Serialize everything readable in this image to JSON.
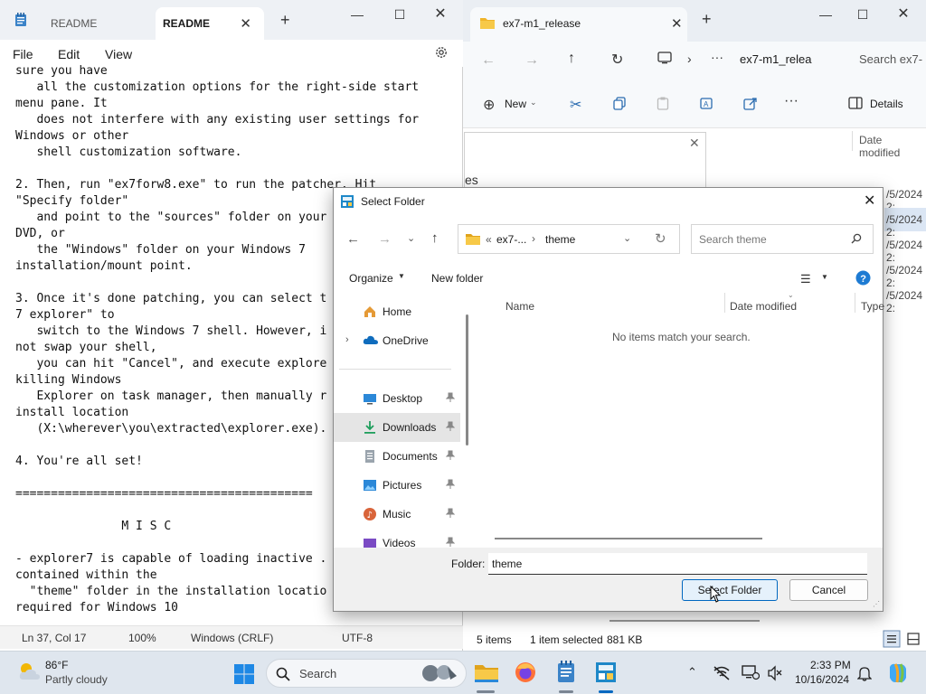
{
  "notepad": {
    "tabs": [
      "README",
      "README"
    ],
    "menu": [
      "File",
      "Edit",
      "View"
    ],
    "content": "sure you have\n   all the customization options for the right-side start\nmenu pane. It\n   does not interfere with any existing user settings for\nWindows or other\n   shell customization software.\n\n2. Then, run \"ex7forw8.exe\" to run the patcher. Hit\n\"Specify folder\"\n   and point to the \"sources\" folder on your\nDVD, or\n   the \"Windows\" folder on your Windows 7\ninstallation/mount point.\n\n3. Once it's done patching, you can select t\n7 explorer\" to\n   switch to the Windows 7 shell. However, i\nnot swap your shell,\n   you can hit \"Cancel\", and execute explore\nkilling Windows\n   Explorer on task manager, then manually r\ninstall location\n   (X:\\wherever\\you\\extracted\\explorer.exe).\n\n4. You're all set!\n\n==========================================\n\n               M I S C\n\n- explorer7 is capable of loading inactive .\ncontained within the\n  \"theme\" folder in the installation locatio\nrequired for Windows 10\n",
    "status": {
      "position": "Ln 37, Col 17",
      "zoom": "100%",
      "line_ending": "Windows (CRLF)",
      "encoding": "UTF-8"
    }
  },
  "explorer": {
    "tab_title": "ex7-m1_release",
    "address": "ex7-m1_relea",
    "search": "Search ex7-",
    "toolbar": {
      "new": "New",
      "details": "Details"
    },
    "column_date": "Date modified",
    "partial_dates": [
      "/5/2024 2:",
      "/5/2024 2:",
      "/5/2024 2:",
      "/5/2024 2:",
      "/5/2024 2:"
    ],
    "fragment": "es",
    "status": {
      "items": "5 items",
      "selected": "1 item selected",
      "size": "881 KB"
    }
  },
  "dialog": {
    "title": "Select Folder",
    "breadcrumb": [
      "«",
      "ex7-...",
      "›",
      "theme"
    ],
    "search_placeholder": "Search theme",
    "organize": "Organize",
    "new_folder": "New folder",
    "nav": [
      {
        "label": "Home",
        "icon": "home-icon"
      },
      {
        "label": "OneDrive",
        "icon": "onedrive-icon"
      },
      {
        "label": "Desktop",
        "icon": "desktop-icon"
      },
      {
        "label": "Downloads",
        "icon": "downloads-icon"
      },
      {
        "label": "Documents",
        "icon": "documents-icon"
      },
      {
        "label": "Pictures",
        "icon": "pictures-icon"
      },
      {
        "label": "Music",
        "icon": "music-icon"
      },
      {
        "label": "Videos",
        "icon": "videos-icon"
      }
    ],
    "columns": [
      "Name",
      "Date modified",
      "Type"
    ],
    "empty_message": "No items match your search.",
    "folder_label": "Folder:",
    "folder_value": "theme",
    "select_button": "Select Folder",
    "cancel_button": "Cancel"
  },
  "taskbar": {
    "weather_temp": "86°F",
    "weather_desc": "Partly cloudy",
    "search": "Search",
    "time": "2:33 PM",
    "date": "10/16/2024"
  },
  "colors": {
    "accent": "#0067c0",
    "taskbar": "#dfe6ee"
  }
}
